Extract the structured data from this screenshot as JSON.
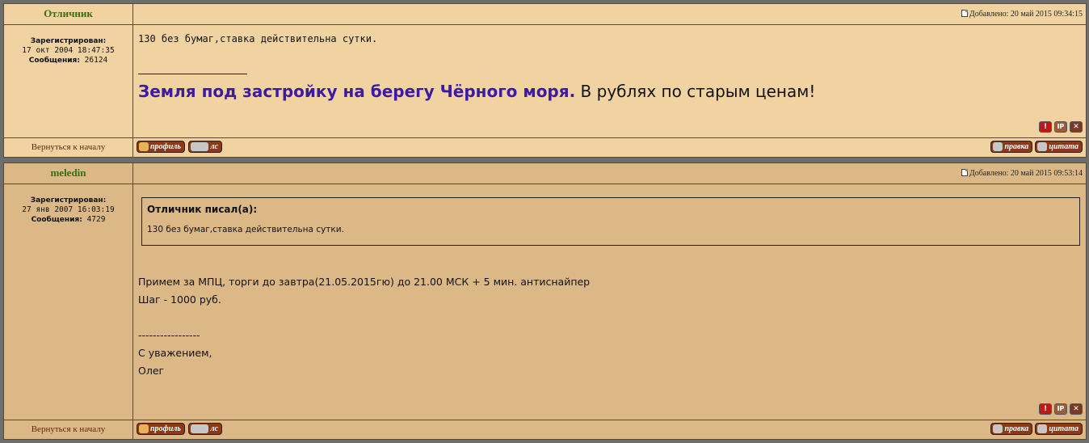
{
  "posts": [
    {
      "author": "Отличник",
      "added": "Добавлено: 20 май 2015 09:34:15",
      "reg_label": "Зарегистрирован:",
      "reg_date": "17 окт 2004 18:47:35",
      "msgs_label": "Сообщения:",
      "msgs_count": "26124",
      "text": "130 без бумаг,ставка действительна сутки.",
      "sig_link": "Земля под застройку на берегу Чёрного моря.",
      "sig_rest": " В рублях по старым ценам!",
      "back": "Вернуться к началу",
      "profile": "профиль",
      "pm": "лс",
      "edit": "правка",
      "quote": "цитата"
    },
    {
      "author": "meledin",
      "added": "Добавлено: 20 май 2015 09:53:14",
      "reg_label": "Зарегистрирован:",
      "reg_date": "27 янв 2007 16:03:19",
      "msgs_label": "Сообщения:",
      "msgs_count": "4729",
      "quote_title": "Отличник писал(а):",
      "quote_text": "130 без бумаг,ставка действительна сутки.",
      "lines": [
        "Примем за МПЦ, торги до завтра(21.05.2015гю) до 21.00 МСК + 5 мин. антиснайпер",
        "Шаг - 1000 руб.",
        "",
        "-----------------",
        "С уважением,",
        "Олег"
      ],
      "back": "Вернуться к началу",
      "profile": "профиль",
      "pm": "лс",
      "edit": "правка",
      "quote": "цитата"
    }
  ],
  "mod_icons": {
    "report": "!",
    "ip": "IP",
    "delete": "✕"
  }
}
